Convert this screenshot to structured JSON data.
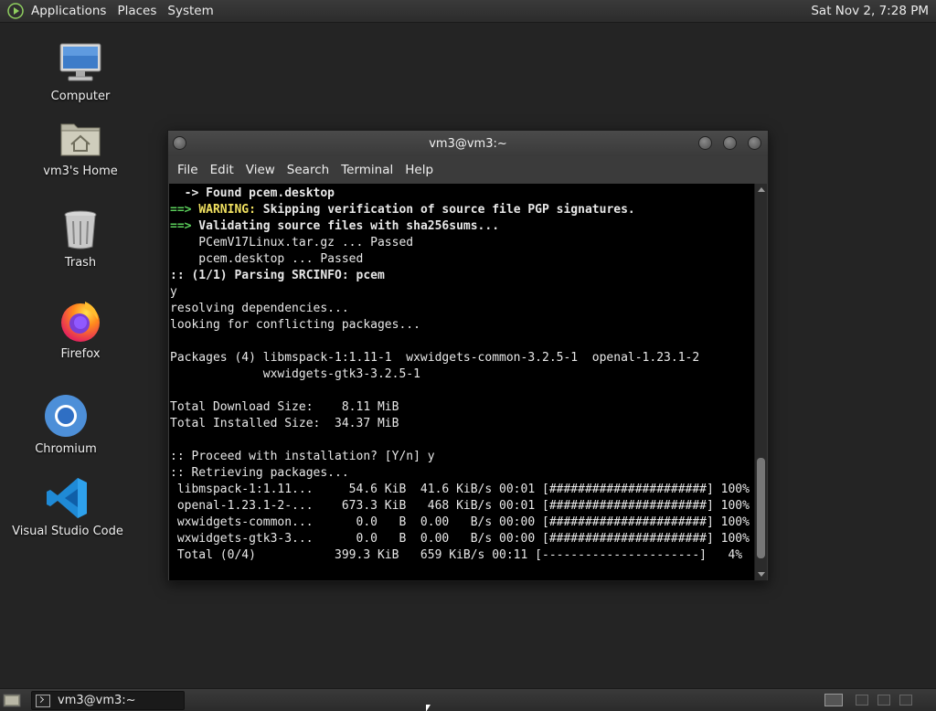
{
  "top_panel": {
    "menus": [
      "Applications",
      "Places",
      "System"
    ],
    "clock": "Sat Nov 2, 7:28 PM"
  },
  "desktop_icons": [
    {
      "label": "Computer",
      "icon": "computer-icon"
    },
    {
      "label": "vm3's Home",
      "icon": "home-folder-icon"
    },
    {
      "label": "Trash",
      "icon": "trash-icon"
    },
    {
      "label": "Firefox",
      "icon": "firefox-icon"
    },
    {
      "label": "Chromium",
      "icon": "chromium-icon"
    },
    {
      "label": "Visual Studio Code",
      "icon": "vscode-icon"
    }
  ],
  "window": {
    "title": "vm3@vm3:~",
    "menus": [
      "File",
      "Edit",
      "View",
      "Search",
      "Terminal",
      "Help"
    ]
  },
  "terminal": {
    "lines": [
      {
        "prefix": "",
        "prefix_class": "",
        "text": "  -> Found pcem.desktop",
        "text_class": "bold"
      },
      {
        "prefix": "==>",
        "prefix_class": "green",
        "text": " WARNING: Skipping verification of source file PGP signatures.",
        "text_class": "bold",
        "warn": "WARNING:"
      },
      {
        "prefix": "==>",
        "prefix_class": "green",
        "text": " Validating source files with sha256sums...",
        "text_class": "bold"
      },
      {
        "prefix": "",
        "prefix_class": "",
        "text": "    PCemV17Linux.tar.gz ... Passed",
        "text_class": ""
      },
      {
        "prefix": "",
        "prefix_class": "",
        "text": "    pcem.desktop ... Passed",
        "text_class": ""
      },
      {
        "prefix": "",
        "prefix_class": "",
        "text": ":: (1/1) Parsing SRCINFO: pcem",
        "text_class": "bold"
      },
      {
        "prefix": "",
        "prefix_class": "",
        "text": "y",
        "text_class": ""
      },
      {
        "prefix": "",
        "prefix_class": "",
        "text": "resolving dependencies...",
        "text_class": ""
      },
      {
        "prefix": "",
        "prefix_class": "",
        "text": "looking for conflicting packages...",
        "text_class": ""
      },
      {
        "prefix": "",
        "prefix_class": "",
        "text": "",
        "text_class": ""
      },
      {
        "prefix": "",
        "prefix_class": "",
        "text": "Packages (4) libmspack-1:1.11-1  wxwidgets-common-3.2.5-1  openal-1.23.1-2",
        "text_class": ""
      },
      {
        "prefix": "",
        "prefix_class": "",
        "text": "             wxwidgets-gtk3-3.2.5-1",
        "text_class": ""
      },
      {
        "prefix": "",
        "prefix_class": "",
        "text": "",
        "text_class": ""
      },
      {
        "prefix": "",
        "prefix_class": "",
        "text": "Total Download Size:    8.11 MiB",
        "text_class": ""
      },
      {
        "prefix": "",
        "prefix_class": "",
        "text": "Total Installed Size:  34.37 MiB",
        "text_class": ""
      },
      {
        "prefix": "",
        "prefix_class": "",
        "text": "",
        "text_class": ""
      },
      {
        "prefix": "",
        "prefix_class": "",
        "text": ":: Proceed with installation? [Y/n] y",
        "text_class": ""
      },
      {
        "prefix": "",
        "prefix_class": "",
        "text": ":: Retrieving packages...",
        "text_class": ""
      },
      {
        "prefix": "",
        "prefix_class": "",
        "text": " libmspack-1:1.11...     54.6 KiB  41.6 KiB/s 00:01 [######################] 100%",
        "text_class": ""
      },
      {
        "prefix": "",
        "prefix_class": "",
        "text": " openal-1.23.1-2-...    673.3 KiB   468 KiB/s 00:01 [######################] 100%",
        "text_class": ""
      },
      {
        "prefix": "",
        "prefix_class": "",
        "text": " wxwidgets-common...      0.0   B  0.00   B/s 00:00 [######################] 100%",
        "text_class": ""
      },
      {
        "prefix": "",
        "prefix_class": "",
        "text": " wxwidgets-gtk3-3...      0.0   B  0.00   B/s 00:00 [######################] 100%",
        "text_class": ""
      },
      {
        "prefix": "",
        "prefix_class": "",
        "text": " Total (0/4)           399.3 KiB   659 KiB/s 00:11 [----------------------]   4%",
        "text_class": ""
      }
    ]
  },
  "taskbar": {
    "task_label": "vm3@vm3:~"
  }
}
